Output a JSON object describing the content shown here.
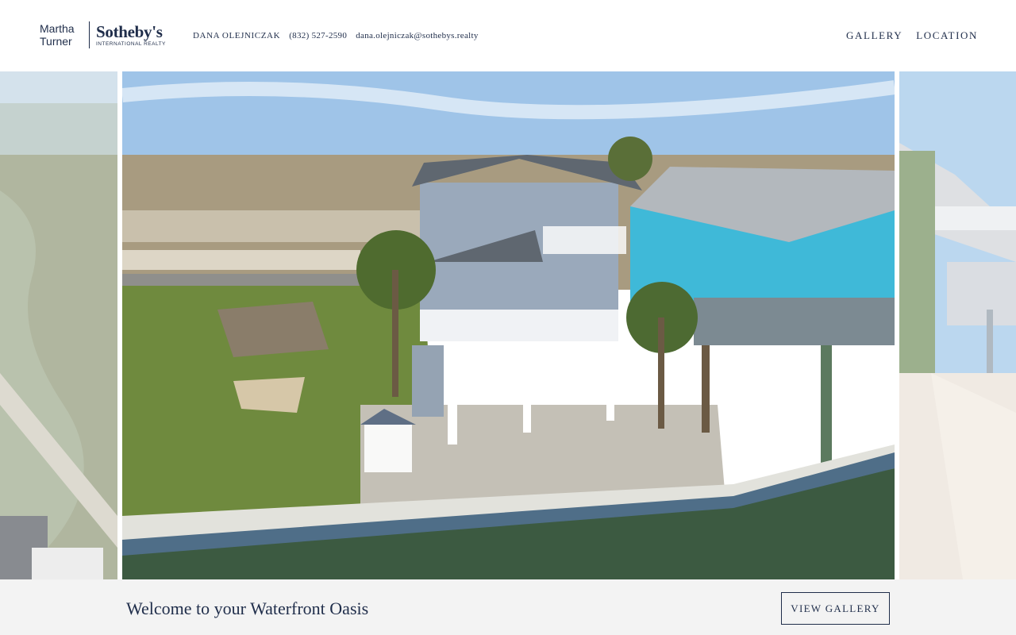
{
  "logo": {
    "left_line1": "Martha",
    "left_line2": "Turner",
    "brand": "Sotheby's",
    "sub": "INTERNATIONAL REALTY"
  },
  "agent": {
    "name": "DANA OLEJNICZAK",
    "phone": "(832) 527-2590",
    "email": "dana.olejniczak@sothebys.realty"
  },
  "nav": {
    "items": [
      {
        "label": "GALLERY"
      },
      {
        "label": "LOCATION"
      }
    ]
  },
  "hero": {
    "caption": "Welcome to your Waterfront Oasis",
    "button_label": "VIEW GALLERY"
  },
  "colors": {
    "brand_navy": "#1f2d4a",
    "caption_bar_bg": "#f3f3f3"
  }
}
